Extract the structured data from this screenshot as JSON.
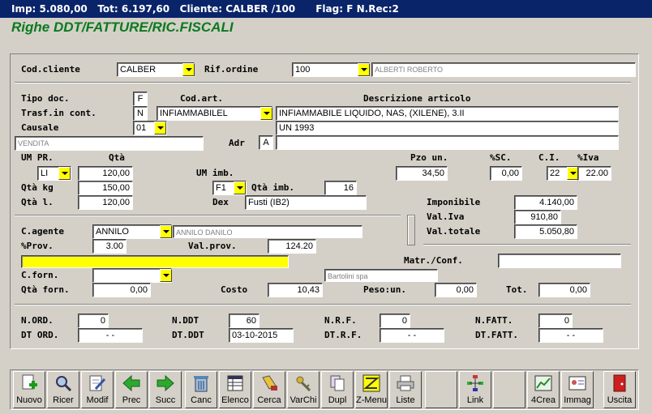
{
  "status_bar": {
    "imp_label": "Imp:",
    "imp_value": "5.080,00",
    "tot_label": "Tot:",
    "tot_value": "6.197,60",
    "cliente_label": "Cliente:",
    "cliente_value": "CALBER /100",
    "flag_label": "Flag:",
    "flag_value": "F",
    "nrec_label": "N.Rec:",
    "nrec_value": "2"
  },
  "heading": "Righe DDT/FATTURE/RIC.FISCALI",
  "header": {
    "cod_cliente_label": "Cod.cliente",
    "cod_cliente_value": "CALBER",
    "rif_ordine_label": "Rif.ordine",
    "rif_ordine_value": "100",
    "cliente_name": "ALBERTI ROBERTO"
  },
  "article": {
    "tipo_doc_label": "Tipo doc.",
    "tipo_doc_value": "F",
    "cod_art_label": "Cod.art.",
    "descr_label": "Descrizione articolo",
    "trasf_label": "Trasf.in cont.",
    "trasf_value": "N",
    "cod_art_value": "INFIAMMABILEL",
    "descr_value_1": "INFIAMMABILE LIQUIDO, NAS, (XILENE), 3.II",
    "causale_label": "Causale",
    "causale_value": "01",
    "descr_value_2": "UN 1993",
    "causale_descr": "VENDITA",
    "adr_label": "Adr",
    "adr_value": "A",
    "adr_descr": ""
  },
  "quantities": {
    "um_pr_label": "UM PR.",
    "qta_label": "Qtà",
    "pzo_un_label": "Pzo un.",
    "sc_label": "%SC.",
    "ci_label": "C.I.",
    "iva_label": "%Iva",
    "um_value": "LI",
    "qta_value": "120,00",
    "um_imb_label": "UM imb.",
    "pzo_value": "34,50",
    "sc_value": "0,00",
    "ci_value": "22",
    "iva_value": "22.00",
    "qta_kg_label": "Qtà kg",
    "qta_kg_value": "150,00",
    "um_imb_value": "F1",
    "qta_imb_label": "Qtà imb.",
    "qta_imb_value": "16",
    "qta_l_label": "Qtà l.",
    "qta_l_value": "120,00",
    "dex_label": "Dex",
    "dex_value": "Fusti (IB2)"
  },
  "totals": {
    "imponibile_label": "Imponibile",
    "imponibile_value": "4.140,00",
    "val_iva_label": "Val.Iva",
    "val_iva_value": "910,80",
    "val_totale_label": "Val.totale",
    "val_totale_value": "5.050,80"
  },
  "agent": {
    "agente_label": "C.agente",
    "agente_value": "ANNILO",
    "agente_name": "ANNILO DANILO",
    "prov_label": "%Prov.",
    "prov_value": "3.00",
    "val_prov_label": "Val.prov.",
    "val_prov_value": "124.20",
    "yellow_value": "",
    "matr_label": "Matr./Conf.",
    "matr_value": "",
    "forn_label": "C.forn.",
    "forn_value": "",
    "forn_name": "Bartolini spa",
    "qta_forn_label": "Qtà forn.",
    "qta_forn_value": "0,00",
    "costo_label": "Costo",
    "costo_value": "10,43",
    "peso_label": "Peso:un.",
    "peso_value": "0,00",
    "tot_label": "Tot.",
    "tot_value": "0,00"
  },
  "refs": {
    "n_ord_label": "N.ORD.",
    "n_ord_value": "0",
    "n_ddt_label": "N.DDT",
    "n_ddt_value": "60",
    "n_rf_label": "N.R.F.",
    "n_rf_value": "0",
    "n_fatt_label": "N.FATT.",
    "n_fatt_value": "0",
    "dt_ord_label": "DT ORD.",
    "dt_ord_value": "-   -",
    "dt_ddt_label": "DT.DDT",
    "dt_ddt_value": "03-10-2015",
    "dt_rf_label": "DT.R.F.",
    "dt_rf_value": "-   -",
    "dt_fatt_label": "DT.FATT.",
    "dt_fatt_value": "-   -"
  },
  "toolbar": {
    "nuovo": "Nuovo",
    "ricer": "Ricer",
    "modif": "Modif",
    "prec": "Prec",
    "succ": "Succ",
    "canc": "Canc",
    "elenco": "Elenco",
    "cerca": "Cerca",
    "varchi": "VarChi",
    "dupl": "Dupl",
    "zmenu": "Z-Menu",
    "liste": "Liste",
    "link": "Link",
    "crea4": "4Crea",
    "immag": "Immag",
    "uscita": "Uscita"
  },
  "colors": {
    "title_bg": "#0a246a",
    "heading": "#0a7a1e",
    "window": "#d4d0c8",
    "highlight": "#ffff00"
  }
}
